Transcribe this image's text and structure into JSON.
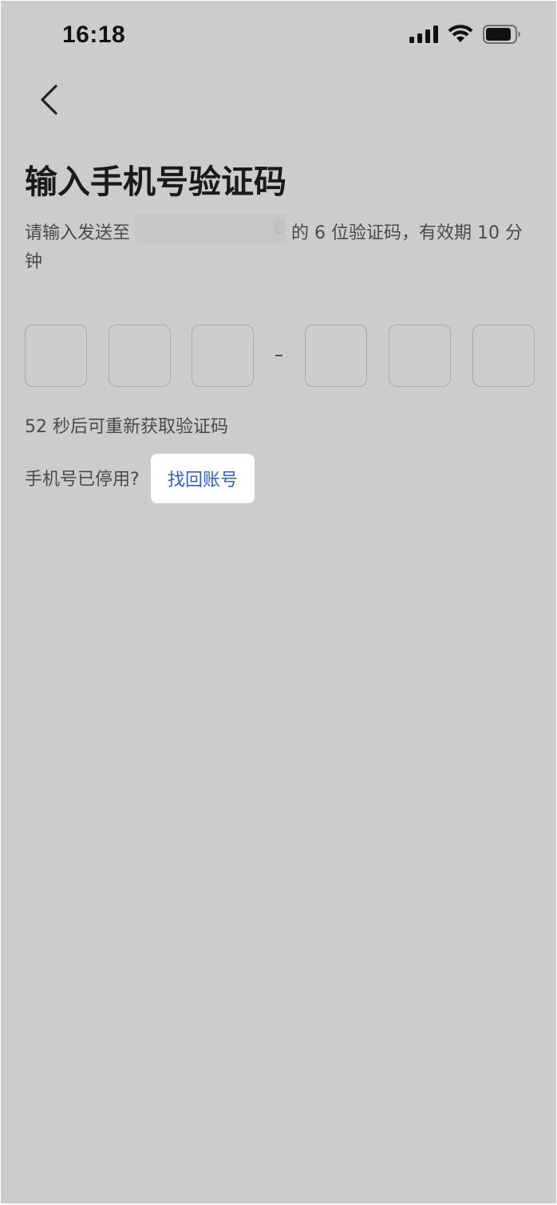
{
  "status_bar": {
    "time": "16:18",
    "icons": [
      "signal-icon",
      "wifi-icon",
      "battery-icon"
    ]
  },
  "nav": {
    "back_icon": "chevron-left-icon"
  },
  "page": {
    "title": "输入手机号验证码",
    "subtitle_prefix": "请输入发送至",
    "masked_phone_tail": "8",
    "subtitle_suffix": "的 6 位验证码，有效期 10 分钟"
  },
  "code_input": {
    "separator": "–",
    "digits": [
      "",
      "",
      "",
      "",
      "",
      ""
    ]
  },
  "resend": {
    "text": "52 秒后可重新获取验证码"
  },
  "recovery": {
    "prompt": "手机号已停用?",
    "link_label": "找回账号"
  },
  "colors": {
    "background": "#cccccc",
    "link": "#2f5fc8",
    "title": "#1a1a1a"
  }
}
